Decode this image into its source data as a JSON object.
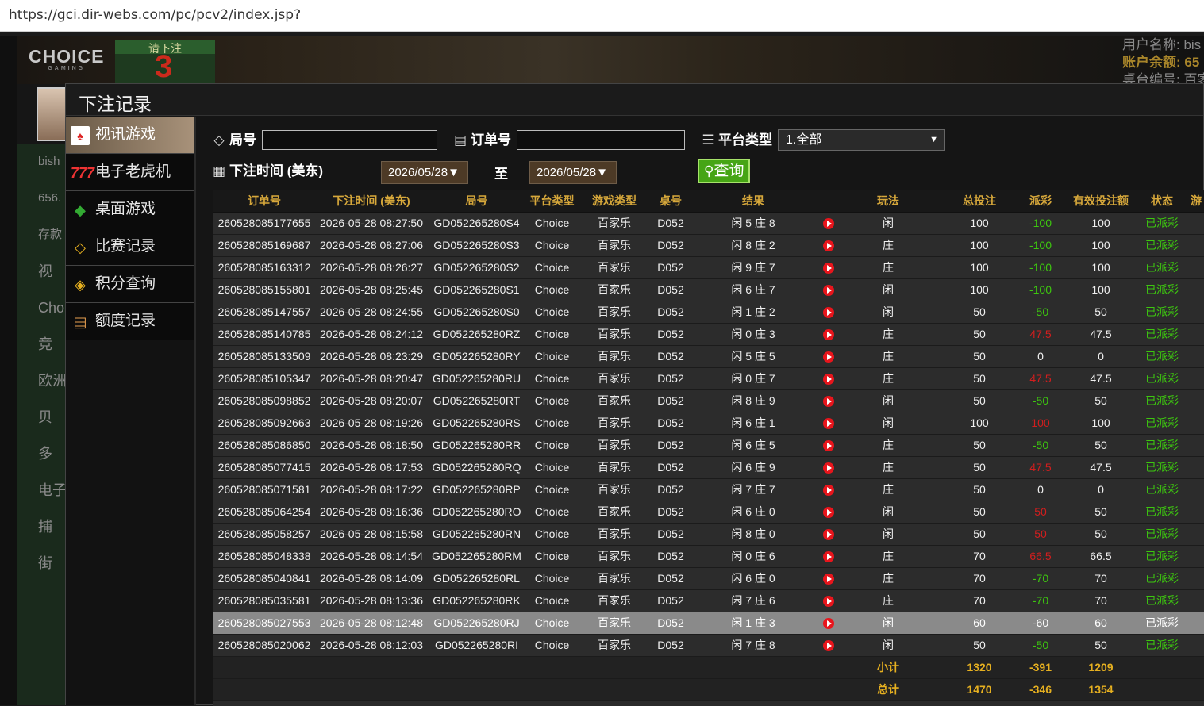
{
  "browser": {
    "url": "https://gci.dir-webs.com/pc/pcv2/index.jsp?"
  },
  "background": {
    "logo": "CHOICE",
    "logo_sub": "GAMING",
    "bet_prompt": "请下注",
    "countdown": "3",
    "user_name_label": "用户名称: bis",
    "balance_label": "账户余额: 65",
    "table_label": "桌台编号: 百家",
    "left_user": "bish",
    "left_balance": "656.",
    "left_items": [
      "存款",
      "视",
      "Cho",
      "竞",
      "欧洲",
      "贝",
      "多",
      "电子",
      "捕",
      "街"
    ]
  },
  "dialog": {
    "title": "下注记录"
  },
  "menu": {
    "items": [
      {
        "label": "视讯游戏",
        "icon": "cards-icon",
        "glyph": "🂡"
      },
      {
        "label": "电子老虎机",
        "icon": "slot-machine-icon",
        "glyph": "7"
      },
      {
        "label": "桌面游戏",
        "icon": "dice-icon",
        "glyph": "◆"
      },
      {
        "label": "比赛记录",
        "icon": "ticket-icon",
        "glyph": "◇"
      },
      {
        "label": "积分查询",
        "icon": "diamond-icon",
        "glyph": "◈"
      },
      {
        "label": "额度记录",
        "icon": "document-icon",
        "glyph": "▤"
      }
    ]
  },
  "filters": {
    "round_label": "局号",
    "round_value": "",
    "order_label": "订单号",
    "order_value": "",
    "platform_label": "平台类型",
    "platform_selected": "1.全部",
    "time_label": "下注时间 (美东)",
    "date_from": "2026/05/28▼",
    "to_label": "至",
    "date_to": "2026/05/28▼",
    "query_label": "查询"
  },
  "table": {
    "headers": [
      "订单号",
      "下注时间 (美东)",
      "局号",
      "平台类型",
      "游戏类型",
      "桌号",
      "结果",
      "",
      "玩法",
      "总投注",
      "派彩",
      "有效投注额",
      "状态",
      "游"
    ],
    "rows": [
      [
        "260528085177655",
        "2026-05-28 08:27:50",
        "GD052265280S4",
        "Choice",
        "百家乐",
        "D052",
        "闲 5 庄 8",
        "闲",
        "100",
        "-100",
        "100",
        "已派彩",
        "neg"
      ],
      [
        "260528085169687",
        "2026-05-28 08:27:06",
        "GD052265280S3",
        "Choice",
        "百家乐",
        "D052",
        "闲 8 庄 2",
        "庄",
        "100",
        "-100",
        "100",
        "已派彩",
        "neg"
      ],
      [
        "260528085163312",
        "2026-05-28 08:26:27",
        "GD052265280S2",
        "Choice",
        "百家乐",
        "D052",
        "闲 9 庄 7",
        "庄",
        "100",
        "-100",
        "100",
        "已派彩",
        "neg"
      ],
      [
        "260528085155801",
        "2026-05-28 08:25:45",
        "GD052265280S1",
        "Choice",
        "百家乐",
        "D052",
        "闲 6 庄 7",
        "闲",
        "100",
        "-100",
        "100",
        "已派彩",
        "neg"
      ],
      [
        "260528085147557",
        "2026-05-28 08:24:55",
        "GD052265280S0",
        "Choice",
        "百家乐",
        "D052",
        "闲 1 庄 2",
        "闲",
        "50",
        "-50",
        "50",
        "已派彩",
        "neg"
      ],
      [
        "260528085140785",
        "2026-05-28 08:24:12",
        "GD052265280RZ",
        "Choice",
        "百家乐",
        "D052",
        "闲 0 庄 3",
        "庄",
        "50",
        "47.5",
        "47.5",
        "已派彩",
        "red"
      ],
      [
        "260528085133509",
        "2026-05-28 08:23:29",
        "GD052265280RY",
        "Choice",
        "百家乐",
        "D052",
        "闲 5 庄 5",
        "庄",
        "50",
        "0",
        "0",
        "已派彩",
        "plain"
      ],
      [
        "260528085105347",
        "2026-05-28 08:20:47",
        "GD052265280RU",
        "Choice",
        "百家乐",
        "D052",
        "闲 0 庄 7",
        "庄",
        "50",
        "47.5",
        "47.5",
        "已派彩",
        "red"
      ],
      [
        "260528085098852",
        "2026-05-28 08:20:07",
        "GD052265280RT",
        "Choice",
        "百家乐",
        "D052",
        "闲 8 庄 9",
        "闲",
        "50",
        "-50",
        "50",
        "已派彩",
        "neg"
      ],
      [
        "260528085092663",
        "2026-05-28 08:19:26",
        "GD052265280RS",
        "Choice",
        "百家乐",
        "D052",
        "闲 6 庄 1",
        "闲",
        "100",
        "100",
        "100",
        "已派彩",
        "red"
      ],
      [
        "260528085086850",
        "2026-05-28 08:18:50",
        "GD052265280RR",
        "Choice",
        "百家乐",
        "D052",
        "闲 6 庄 5",
        "庄",
        "50",
        "-50",
        "50",
        "已派彩",
        "neg"
      ],
      [
        "260528085077415",
        "2026-05-28 08:17:53",
        "GD052265280RQ",
        "Choice",
        "百家乐",
        "D052",
        "闲 6 庄 9",
        "庄",
        "50",
        "47.5",
        "47.5",
        "已派彩",
        "red"
      ],
      [
        "260528085071581",
        "2026-05-28 08:17:22",
        "GD052265280RP",
        "Choice",
        "百家乐",
        "D052",
        "闲 7 庄 7",
        "庄",
        "50",
        "0",
        "0",
        "已派彩",
        "plain"
      ],
      [
        "260528085064254",
        "2026-05-28 08:16:36",
        "GD052265280RO",
        "Choice",
        "百家乐",
        "D052",
        "闲 6 庄 0",
        "闲",
        "50",
        "50",
        "50",
        "已派彩",
        "red"
      ],
      [
        "260528085058257",
        "2026-05-28 08:15:58",
        "GD052265280RN",
        "Choice",
        "百家乐",
        "D052",
        "闲 8 庄 0",
        "闲",
        "50",
        "50",
        "50",
        "已派彩",
        "red"
      ],
      [
        "260528085048338",
        "2026-05-28 08:14:54",
        "GD052265280RM",
        "Choice",
        "百家乐",
        "D052",
        "闲 0 庄 6",
        "庄",
        "70",
        "66.5",
        "66.5",
        "已派彩",
        "red"
      ],
      [
        "260528085040841",
        "2026-05-28 08:14:09",
        "GD052265280RL",
        "Choice",
        "百家乐",
        "D052",
        "闲 6 庄 0",
        "庄",
        "70",
        "-70",
        "70",
        "已派彩",
        "neg"
      ],
      [
        "260528085035581",
        "2026-05-28 08:13:36",
        "GD052265280RK",
        "Choice",
        "百家乐",
        "D052",
        "闲 7 庄 6",
        "庄",
        "70",
        "-70",
        "70",
        "已派彩",
        "neg"
      ],
      [
        "260528085027553",
        "2026-05-28 08:12:48",
        "GD052265280RJ",
        "Choice",
        "百家乐",
        "D052",
        "闲 1 庄 3",
        "闲",
        "60",
        "-60",
        "60",
        "已派彩",
        "neg"
      ],
      [
        "260528085020062",
        "2026-05-28 08:12:03",
        "GD052265280RI",
        "Choice",
        "百家乐",
        "D052",
        "闲 7 庄 8",
        "闲",
        "50",
        "-50",
        "50",
        "已派彩",
        "neg"
      ]
    ],
    "highlighted_row": 18,
    "subtotal": {
      "label": "小计",
      "total_bet": "1320",
      "payout": "-391",
      "valid_bet": "1209"
    },
    "total": {
      "label": "总计",
      "total_bet": "1470",
      "payout": "-346",
      "valid_bet": "1354"
    }
  },
  "colors": {
    "header_gold": "#d7a83b",
    "status_green": "#3dc70f",
    "win_red": "#d21e1e",
    "query_green": "#46a515"
  }
}
